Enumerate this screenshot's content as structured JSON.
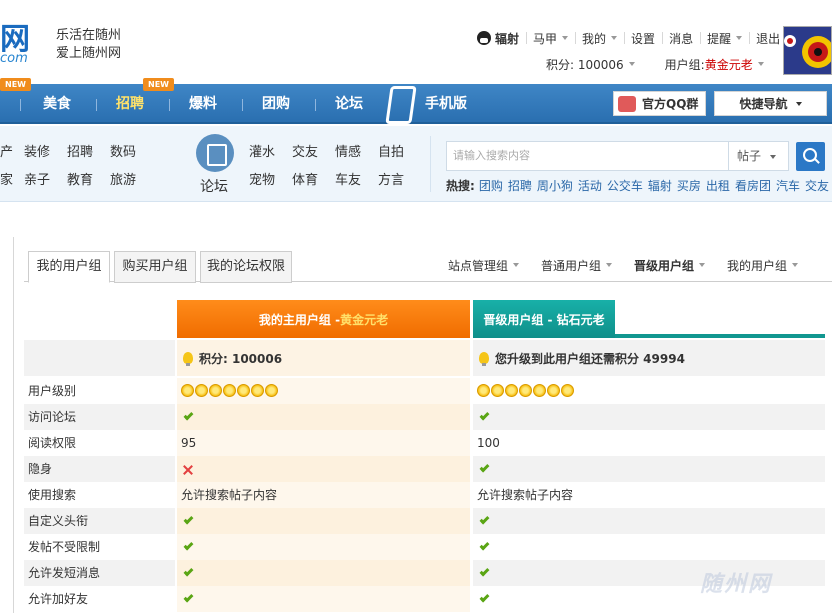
{
  "header": {
    "logo_mark": "网",
    "logo_sub": "com",
    "slogan_line1": "乐活在随州",
    "slogan_line2": "爱上随州网",
    "user_name": "辐射",
    "topnav": [
      "马甲",
      "我的",
      "设置",
      "消息",
      "提醒",
      "退出"
    ],
    "points_label": "积分: 100006",
    "group_label": "用户组:",
    "group_value": "黄金元老"
  },
  "mainnav": {
    "items": [
      "美食",
      "招聘",
      "爆料",
      "团购",
      "论坛",
      "手机版"
    ],
    "new_badge": "NEW",
    "qq_group": "官方QQ群",
    "quick_nav": "快捷导航"
  },
  "categories": {
    "left_col1": [
      "产",
      "家"
    ],
    "left_col2": [
      "装修",
      "亲子"
    ],
    "left_col3": [
      "招聘",
      "教育"
    ],
    "left_col4": [
      "数码",
      "旅游"
    ],
    "forum_label": "论坛",
    "forum_row1": [
      "灌水",
      "交友",
      "情感",
      "自拍"
    ],
    "forum_row2": [
      "宠物",
      "体育",
      "车友",
      "方言"
    ]
  },
  "search": {
    "placeholder": "请输入搜索内容",
    "type": "帖子",
    "hot_label": "热搜:",
    "hot_words": [
      "团购",
      "招聘",
      "周小狗",
      "活动",
      "公交车",
      "辐射",
      "买房",
      "出租",
      "看房团",
      "汽车",
      "交友"
    ]
  },
  "tabs": [
    "我的用户组",
    "购买用户组",
    "我的论坛权限"
  ],
  "group_links": [
    "站点管理组",
    "普通用户组",
    "晋级用户组",
    "我的用户组"
  ],
  "table": {
    "main_head_prefix": "我的主用户组 - ",
    "main_head_value": "黄金元老",
    "upgrade_head": "晋级用户组 - 钻石元老",
    "points_a": "积分: 100006",
    "points_b": "您升级到此用户组还需积分 49994",
    "rows": [
      {
        "label": "用户级别",
        "a": "stars",
        "b": "stars"
      },
      {
        "label": "访问论坛",
        "a": "check",
        "b": "check"
      },
      {
        "label": "阅读权限",
        "a": "95",
        "b": "100"
      },
      {
        "label": "隐身",
        "a": "cross",
        "b": "check"
      },
      {
        "label": "使用搜索",
        "a": "允许搜索帖子内容",
        "b": "允许搜索帖子内容"
      },
      {
        "label": "自定义头衔",
        "a": "check",
        "b": "check"
      },
      {
        "label": "发帖不受限制",
        "a": "check",
        "b": "check"
      },
      {
        "label": "允许发短消息",
        "a": "check",
        "b": "check"
      },
      {
        "label": "允许加好友",
        "a": "check",
        "b": "check"
      }
    ],
    "star_count": 7
  },
  "watermark": "随州网"
}
